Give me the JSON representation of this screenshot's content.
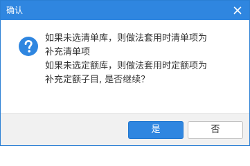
{
  "dialog": {
    "title": "确认",
    "message_lines": [
      "如果未选清单库，则做法套用时清单项为",
      "补充清单项",
      "如果未选定额库，则做法套用时定额项为",
      "补充定额子目, 是否继续？"
    ],
    "icon": "question-icon",
    "close_icon": "close-icon"
  },
  "buttons": {
    "yes_label": "是",
    "no_label": "否"
  },
  "colors": {
    "accent": "#2f86e0",
    "footer_bg": "#f1f1f1",
    "text": "#333333"
  }
}
